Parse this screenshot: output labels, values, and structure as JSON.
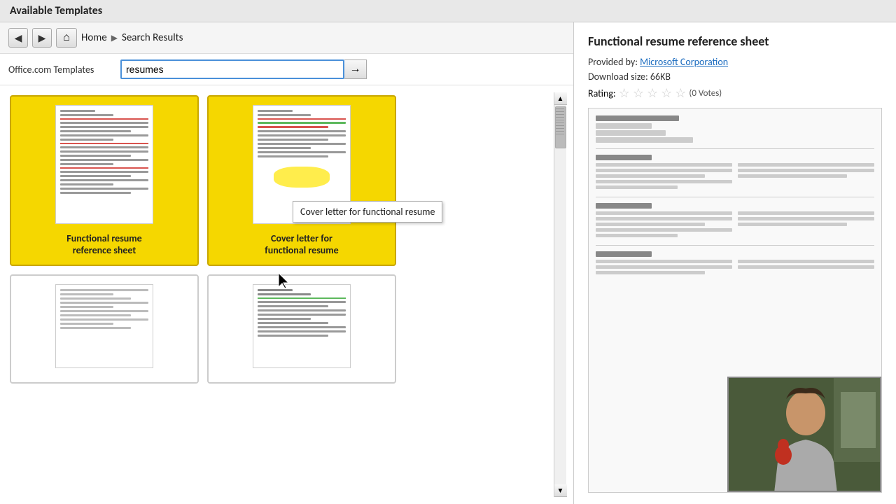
{
  "app": {
    "available_templates_title": "Available Templates"
  },
  "nav": {
    "home_label": "Home",
    "search_results_label": "Search Results",
    "back_icon": "◀",
    "forward_icon": "▶",
    "home_icon": "⌂",
    "sep_icon": "▶"
  },
  "search": {
    "label": "Office.com Templates",
    "value": "resumes",
    "go_icon": "→"
  },
  "templates": {
    "grid": [
      {
        "id": "functional-resume-ref",
        "label": "Functional resume reference sheet",
        "selected": true,
        "row": 1
      },
      {
        "id": "cover-letter-functional",
        "label": "Cover letter for functional resume",
        "selected": true,
        "row": 1
      },
      {
        "id": "template-3",
        "label": "",
        "selected": false,
        "row": 2
      },
      {
        "id": "template-4",
        "label": "",
        "selected": false,
        "row": 2
      }
    ]
  },
  "detail": {
    "title": "Functional resume reference sheet",
    "provided_by_label": "Provided by: ",
    "provider": "Microsoft Corporation",
    "download_size_label": "Download size: ",
    "download_size": "66KB",
    "rating_label": "Rating:",
    "votes": "(0 Votes)"
  },
  "tooltip": {
    "text": "Cover letter for functional resume"
  },
  "scrollbar": {
    "up_icon": "▲",
    "down_icon": "▼",
    "grip_icon": "≡"
  }
}
